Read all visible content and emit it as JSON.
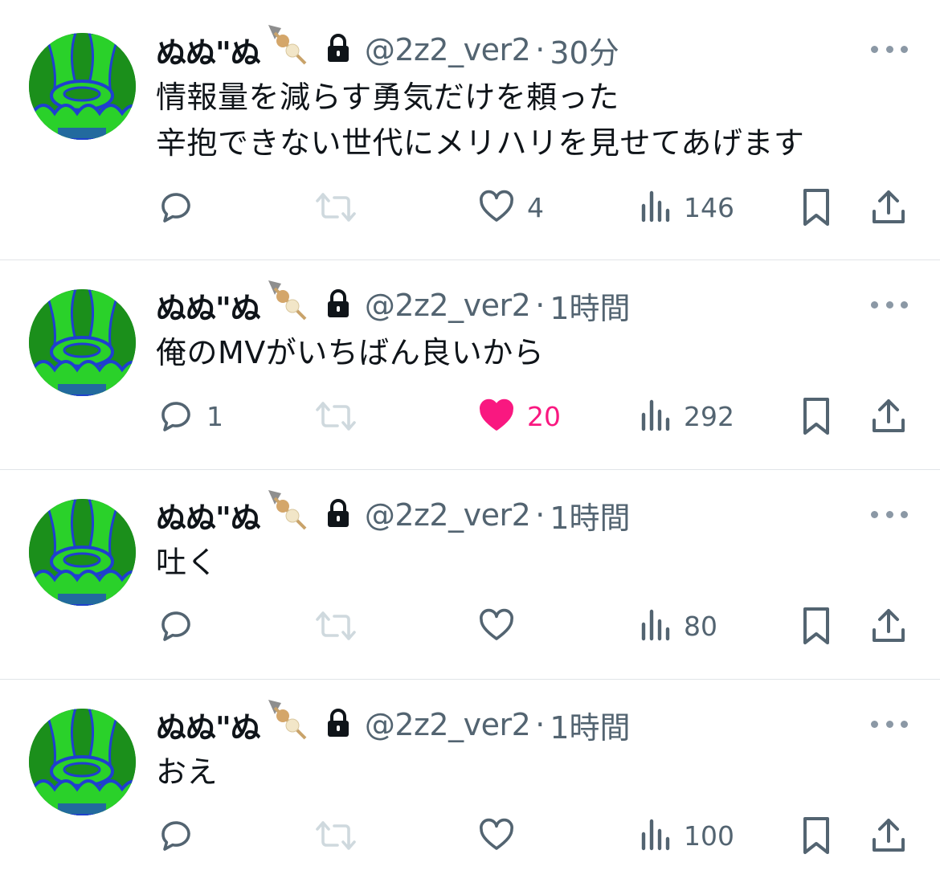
{
  "colors": {
    "text": "#0f1419",
    "muted": "#536471",
    "like_active": "#f91880",
    "retweet_disabled": "#cfd9de",
    "divider": "#e1e4e8",
    "avatar_green": "#22c022",
    "avatar_blue": "#1f3fd0"
  },
  "icons": {
    "name_emoji": "dango-skewer-emoji",
    "protected": "lock-icon",
    "reply": "reply-bubble-icon",
    "retweet": "retweet-icon",
    "like": "heart-icon",
    "views": "bar-chart-icon",
    "bookmark": "bookmark-icon",
    "share": "share-upload-icon",
    "more": "ellipsis-icon"
  },
  "tweets": [
    {
      "name": "ぬぬ\"ぬ",
      "handle": "@2z2_ver2",
      "separator": "·",
      "time": "30分",
      "text": "情報量を減らす勇気だけを頼った\n辛抱できない世代にメリハリを見せてあげます",
      "replies": "",
      "likes": "4",
      "liked": false,
      "views": "146"
    },
    {
      "name": "ぬぬ\"ぬ",
      "handle": "@2z2_ver2",
      "separator": "·",
      "time": "1時間",
      "text": "俺のMVがいちばん良いから",
      "replies": "1",
      "likes": "20",
      "liked": true,
      "views": "292"
    },
    {
      "name": "ぬぬ\"ぬ",
      "handle": "@2z2_ver2",
      "separator": "·",
      "time": "1時間",
      "text": "吐く",
      "replies": "",
      "likes": "",
      "liked": false,
      "views": "80"
    },
    {
      "name": "ぬぬ\"ぬ",
      "handle": "@2z2_ver2",
      "separator": "·",
      "time": "1時間",
      "text": "おえ",
      "replies": "",
      "likes": "",
      "liked": false,
      "views": "100"
    }
  ]
}
